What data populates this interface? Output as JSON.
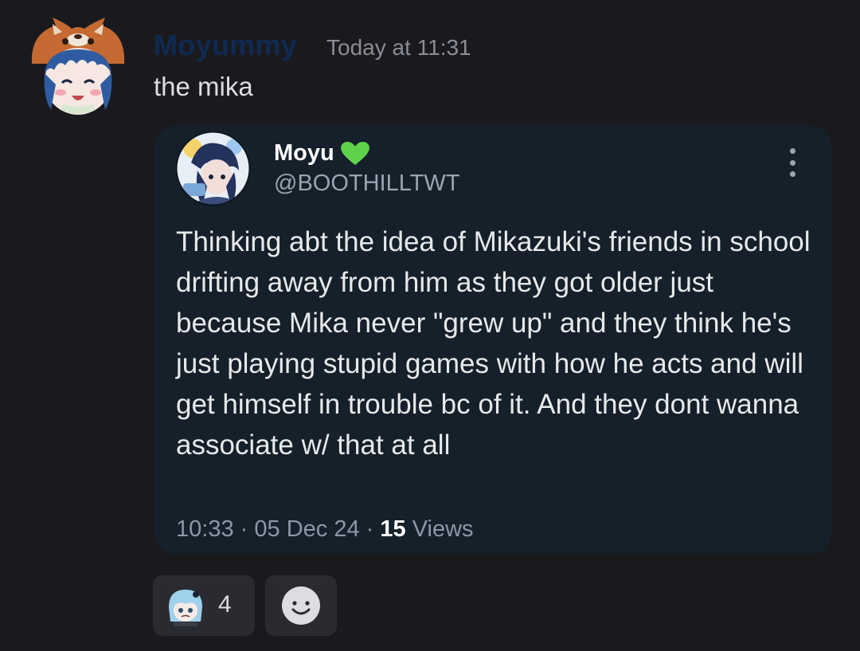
{
  "message": {
    "author": "Moyummy",
    "timestamp": "Today at 11:31",
    "text": "the mika",
    "avatar_icon": "red-panda-hat-avatar-icon"
  },
  "embed": {
    "display_name": "Moyu",
    "verified_icon": "green-heart-icon",
    "handle": "@BOOTHILLTWT",
    "text": "Thinking abt the idea of Mikazuki's friends in school drifting away from him as they got older just because Mika never \"grew up\" and they think he's just playing stupid games with how he acts and will get himself in trouble bc of it. And they dont wanna associate w/ that at all",
    "time": "10:33",
    "date": "05 Dec 24",
    "views_count": "15",
    "views_label": "Views",
    "separator": "·",
    "background": "#15202b"
  },
  "reactions": [
    {
      "emoji_icon": "blue-haired-character-emoji-icon",
      "count": "4"
    }
  ],
  "add_reaction_icon": "smiley-face-icon",
  "colors": {
    "background": "#1a1a1e",
    "author_name": "#0f2a52",
    "muted_text": "#8a8d96",
    "heart": "#5fd14a"
  }
}
